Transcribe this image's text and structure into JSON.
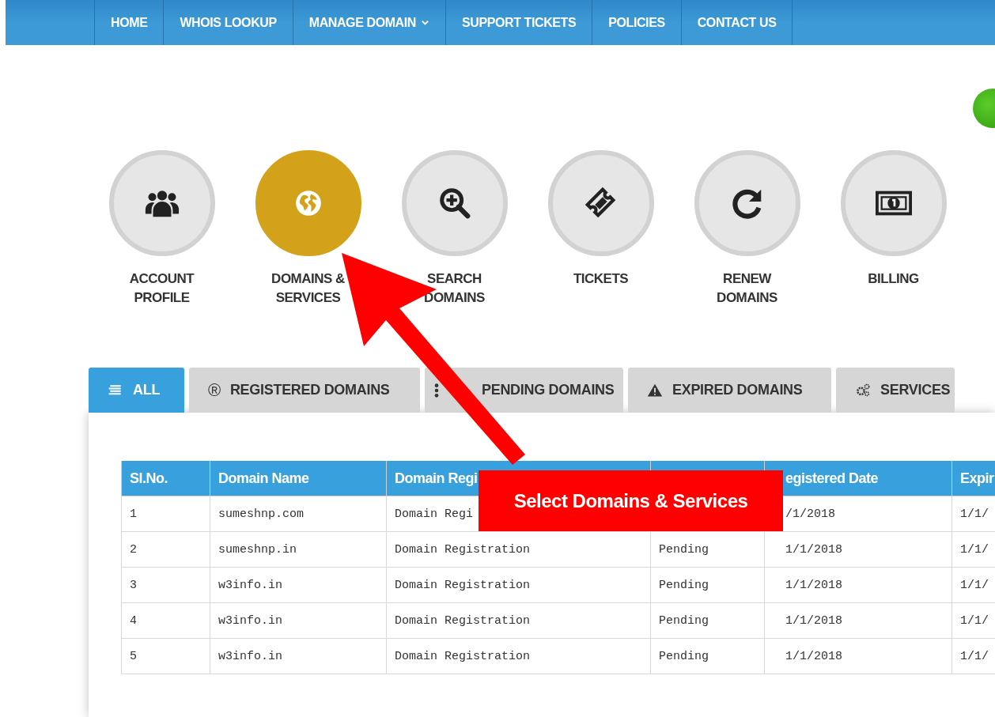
{
  "nav": {
    "items": [
      {
        "label": "HOME",
        "dropdown": false
      },
      {
        "label": "WHOIS LOOKUP",
        "dropdown": false
      },
      {
        "label": "MANAGE DOMAIN",
        "dropdown": true
      },
      {
        "label": "SUPPORT TICKETS",
        "dropdown": false
      },
      {
        "label": "POLICIES",
        "dropdown": false
      },
      {
        "label": "CONTACT US",
        "dropdown": false
      }
    ]
  },
  "quick_links": [
    {
      "label": "ACCOUNT\nPROFILE",
      "selected": false
    },
    {
      "label": "DOMAINS &\nSERVICES",
      "selected": true
    },
    {
      "label": "SEARCH\nDOMAINS",
      "selected": false
    },
    {
      "label": "TICKETS",
      "selected": false
    },
    {
      "label": "RENEW\nDOMAINS",
      "selected": false
    },
    {
      "label": "BILLING",
      "selected": false
    }
  ],
  "tabs": [
    {
      "label": "ALL",
      "selected": true
    },
    {
      "label": "REGISTERED DOMAINS",
      "selected": false,
      "symbol": "®"
    },
    {
      "label": "PENDING DOMAINS",
      "selected": false
    },
    {
      "label": "EXPIRED DOMAINS",
      "selected": false
    },
    {
      "label": "SERVICES",
      "selected": false
    }
  ],
  "table": {
    "columns": [
      "Sl.No.",
      "Domain Name",
      "Domain Regi",
      null,
      "egistered Date",
      "Expir"
    ],
    "rows": [
      [
        "1",
        "sumeshnp.com",
        "Domain Regi",
        null,
        "/1/2018",
        "1/1/"
      ],
      [
        "2",
        "sumeshnp.in",
        "Domain Registration",
        "Pending",
        "1/1/2018",
        "1/1/"
      ],
      [
        "3",
        "w3info.in",
        "Domain Registration",
        "Pending",
        "1/1/2018",
        "1/1/"
      ],
      [
        "4",
        "w3info.in",
        "Domain Registration",
        "Pending",
        "1/1/2018",
        "1/1/"
      ],
      [
        "5",
        "w3info.in",
        "Domain Registration",
        "Pending",
        "1/1/2018",
        "1/1/"
      ]
    ]
  },
  "annotation": {
    "callout": "Select Domains & Services"
  }
}
